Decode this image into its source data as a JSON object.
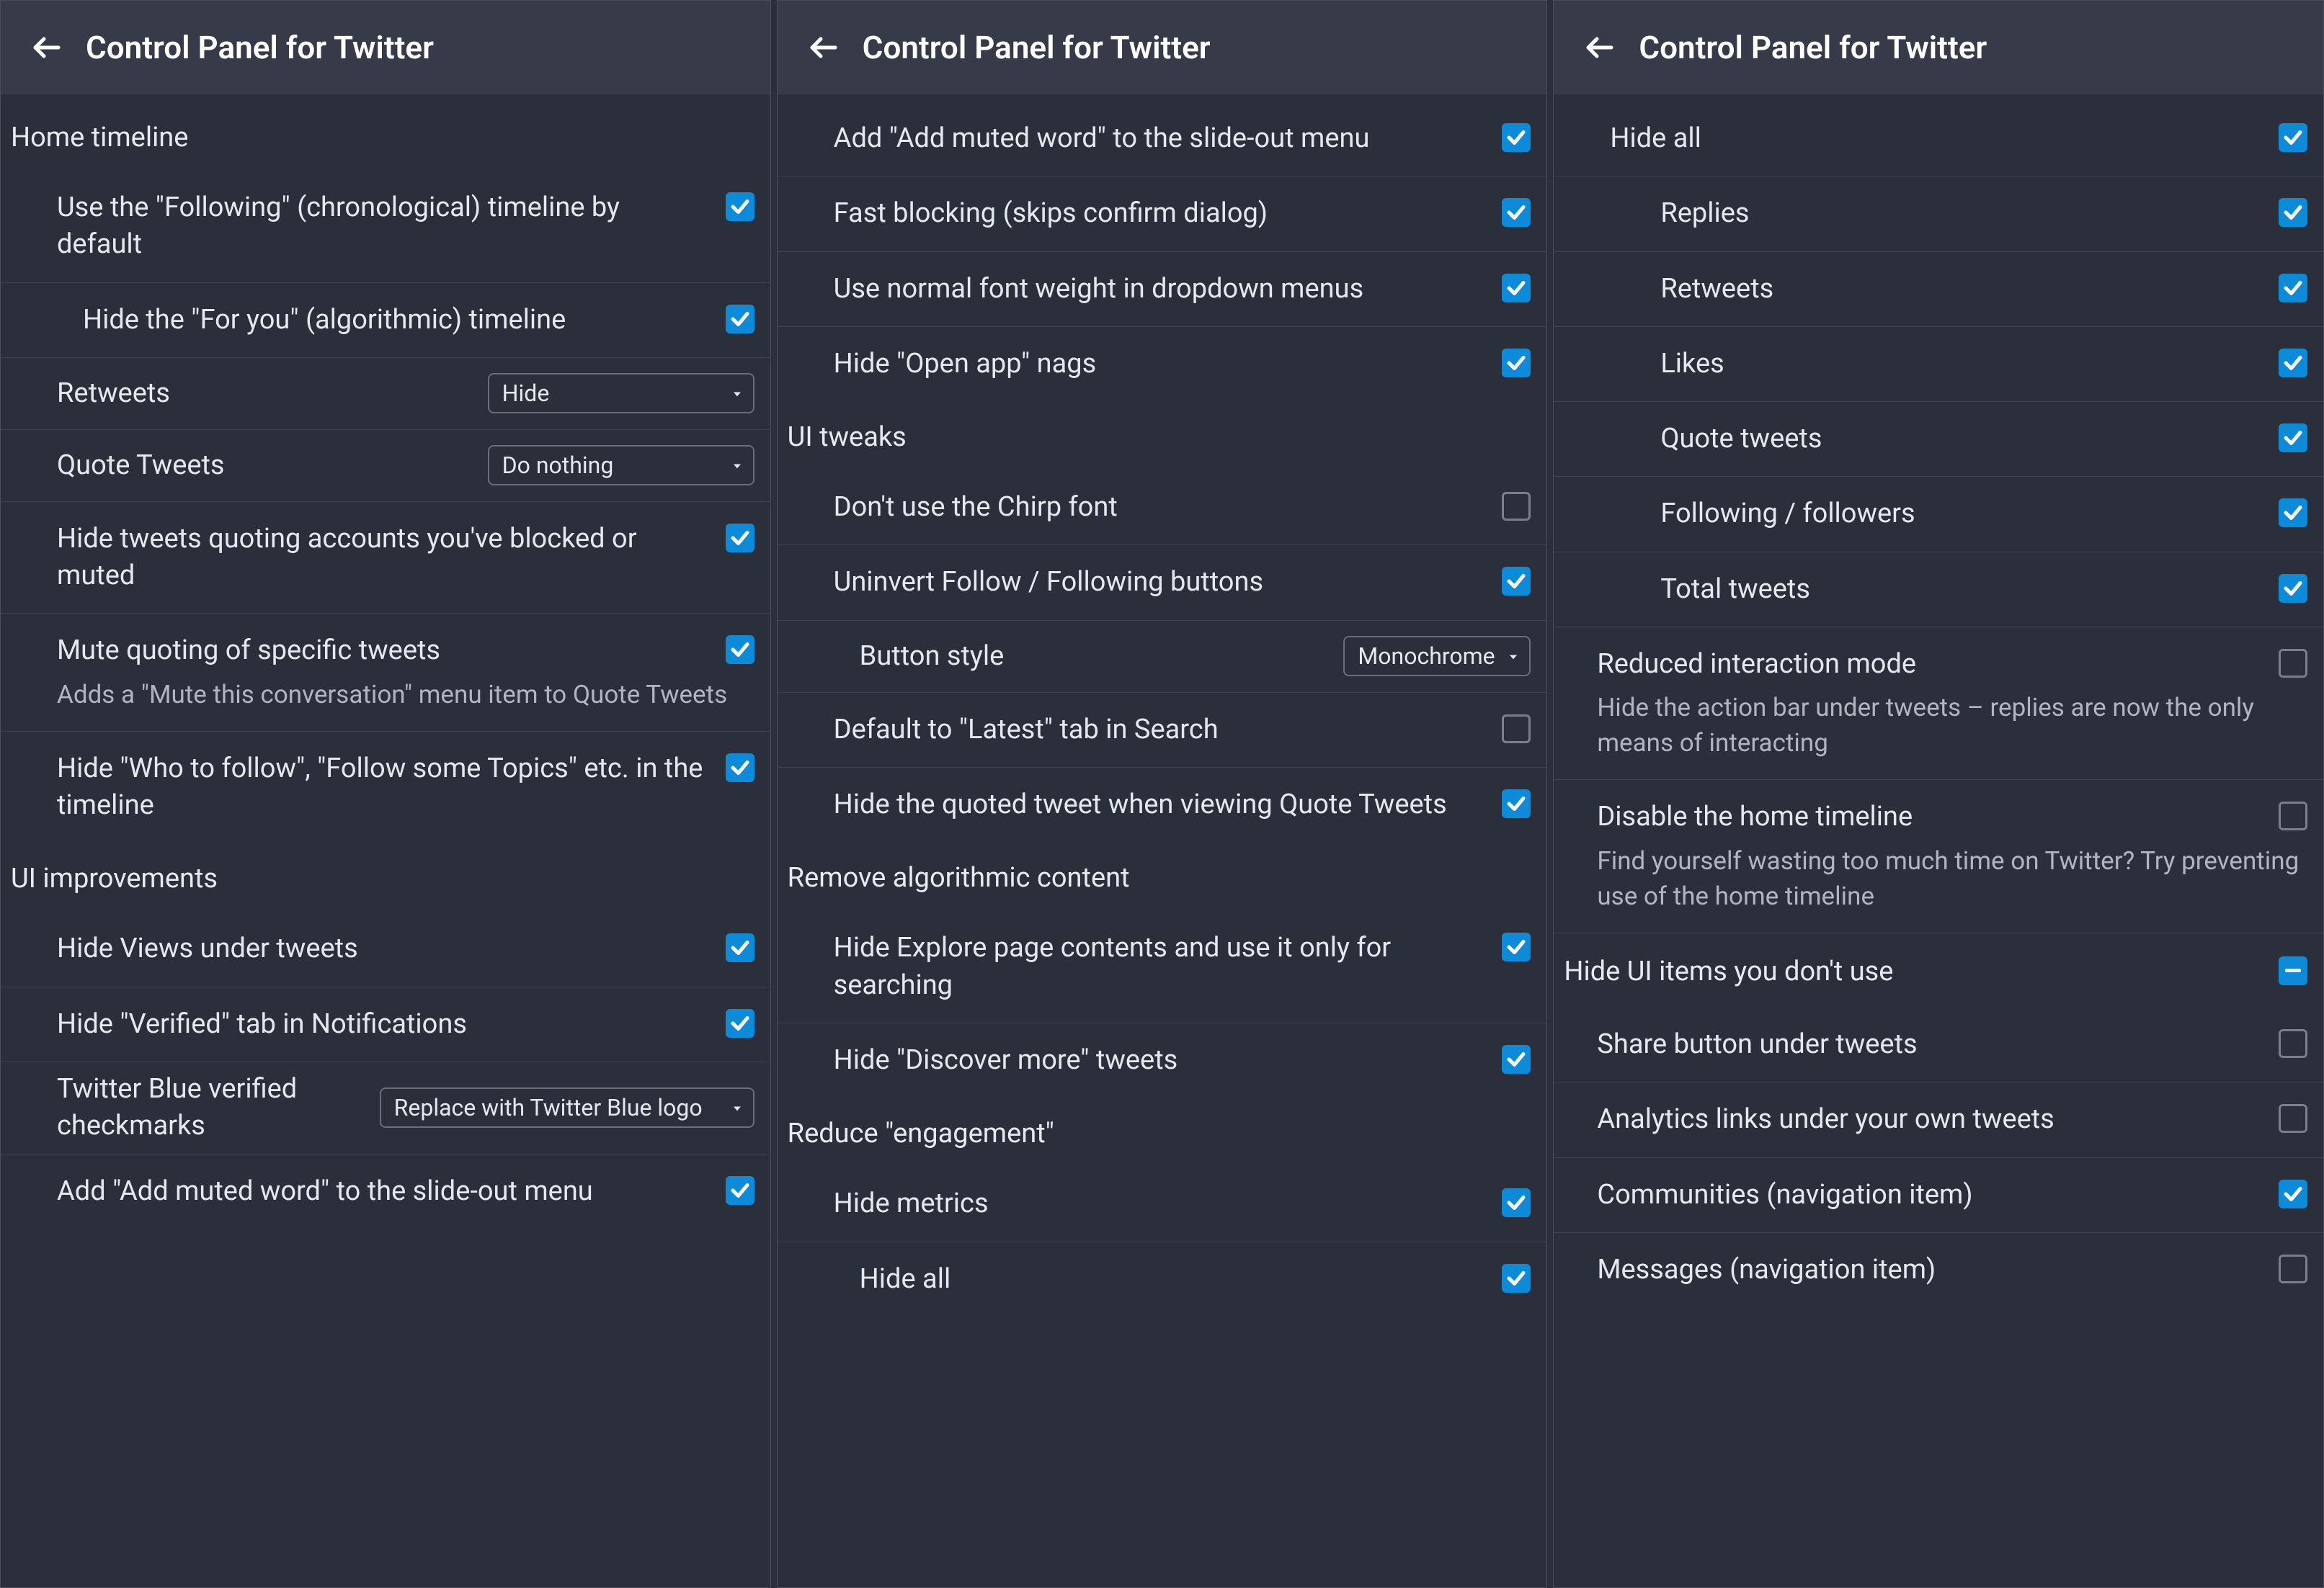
{
  "title": "Control Panel for Twitter",
  "panel1": {
    "section1": "Home timeline",
    "r1": "Use the \"Following\" (chronological) timeline by default",
    "r2": "Hide the \"For you\" (algorithmic) timeline",
    "r3": "Retweets",
    "r3v": "Hide",
    "r4": "Quote Tweets",
    "r4v": "Do nothing",
    "r5": "Hide tweets quoting accounts you've blocked or muted",
    "r6": "Mute quoting of specific tweets",
    "r6d": "Adds a \"Mute this conversation\" menu item to Quote Tweets",
    "r7": "Hide \"Who to follow\", \"Follow some Topics\" etc. in the timeline",
    "section2": "UI improvements",
    "r8": "Hide Views under tweets",
    "r9": "Hide \"Verified\" tab in Notifications",
    "r10": "Twitter Blue verified checkmarks",
    "r10v": "Replace with Twitter Blue logo",
    "r11": "Add \"Add muted word\" to the slide-out menu"
  },
  "panel2": {
    "r1": "Add \"Add muted word\" to the slide-out menu",
    "r2": "Fast blocking (skips confirm dialog)",
    "r3": "Use normal font weight in dropdown menus",
    "r4": "Hide \"Open app\" nags",
    "section1": "UI tweaks",
    "r5": "Don't use the Chirp font",
    "r6": "Uninvert Follow / Following buttons",
    "r7": "Button style",
    "r7v": "Monochrome",
    "r8": "Default to \"Latest\" tab in Search",
    "r9": "Hide the quoted tweet when viewing Quote Tweets",
    "section2": "Remove algorithmic content",
    "r10": "Hide Explore page contents and use it only for searching",
    "r11": "Hide \"Discover more\" tweets",
    "section3": "Reduce \"engagement\"",
    "r12": "Hide metrics",
    "r13": "Hide all"
  },
  "panel3": {
    "r1": "Hide all",
    "r2": "Replies",
    "r3": "Retweets",
    "r4": "Likes",
    "r5": "Quote tweets",
    "r6": "Following / followers",
    "r7": "Total tweets",
    "r8": "Reduced interaction mode",
    "r8d": "Hide the action bar under tweets – replies are now the only means of interacting",
    "r9": "Disable the home timeline",
    "r9d": "Find yourself wasting too much time on Twitter? Try preventing use of the home timeline",
    "section1": "Hide UI items you don't use",
    "r10": "Share button under tweets",
    "r11": "Analytics links under your own tweets",
    "r12": "Communities (navigation item)",
    "r13": "Messages (navigation item)"
  }
}
